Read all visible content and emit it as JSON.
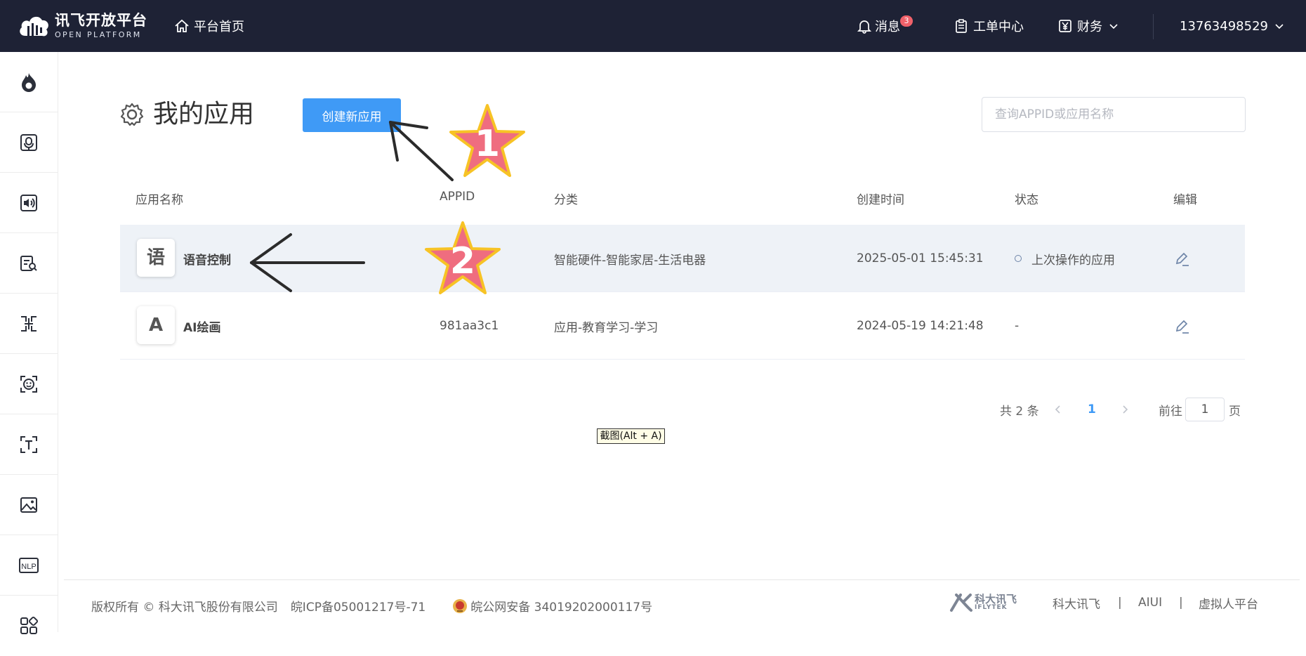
{
  "header": {
    "logo_cn": "讯飞开放平台",
    "logo_en": "OPEN PLATFORM",
    "home_label": "平台首页",
    "messages_label": "消息",
    "messages_count": "3",
    "tickets_label": "工单中心",
    "finance_label": "财务",
    "user_label": "13763498529"
  },
  "sidebar": {
    "items": [
      "flame-icon",
      "microphone-icon",
      "speaker-icon",
      "ocr-icon",
      "translate-icon",
      "face-icon",
      "text-icon",
      "image-icon",
      "nlp-icon",
      "apps-grid-icon"
    ],
    "nlp_text": "NLP"
  },
  "main": {
    "title": "我的应用",
    "create_button": "创建新应用",
    "search_placeholder": "查询APPID或应用名称"
  },
  "table": {
    "headers": [
      "应用名称",
      "APPID",
      "分类",
      "创建时间",
      "状态",
      "编辑"
    ],
    "rows": [
      {
        "icon_char": "语",
        "name": "语音控制",
        "appid": "",
        "category": "智能硬件-智能家居-生活电器",
        "created": "2025-05-01 15:45:31",
        "status": "上次操作的应用"
      },
      {
        "icon_char": "A",
        "name": "AI绘画",
        "appid": "981aa3c1",
        "category": "应用-教育学习-学习",
        "created": "2024-05-19 14:21:48",
        "status": "-"
      }
    ]
  },
  "pagination": {
    "total": "共 2 条",
    "current": "1",
    "goto_label": "前往",
    "goto_value": "1",
    "page_suffix": "页"
  },
  "tooltip": "截图(Alt + A)",
  "annotations": {
    "star1": "1",
    "star2": "2"
  },
  "footer": {
    "copyright": "版权所有 © 科大讯飞股份有限公司",
    "icp": "皖ICP备05001217号-71",
    "police": "皖公网安备 34019202000117号",
    "brand_cn": "科大讯飞",
    "brand_en": "IFLYTEK",
    "links": [
      "科大讯飞",
      "|",
      "AIUI",
      "|",
      "虚拟人平台"
    ]
  },
  "colors": {
    "topbar": "#1e2235",
    "primary": "#3f9af6",
    "badge": "#f0616a",
    "star": "#ef6d7f",
    "star_border": "#f7c325"
  }
}
